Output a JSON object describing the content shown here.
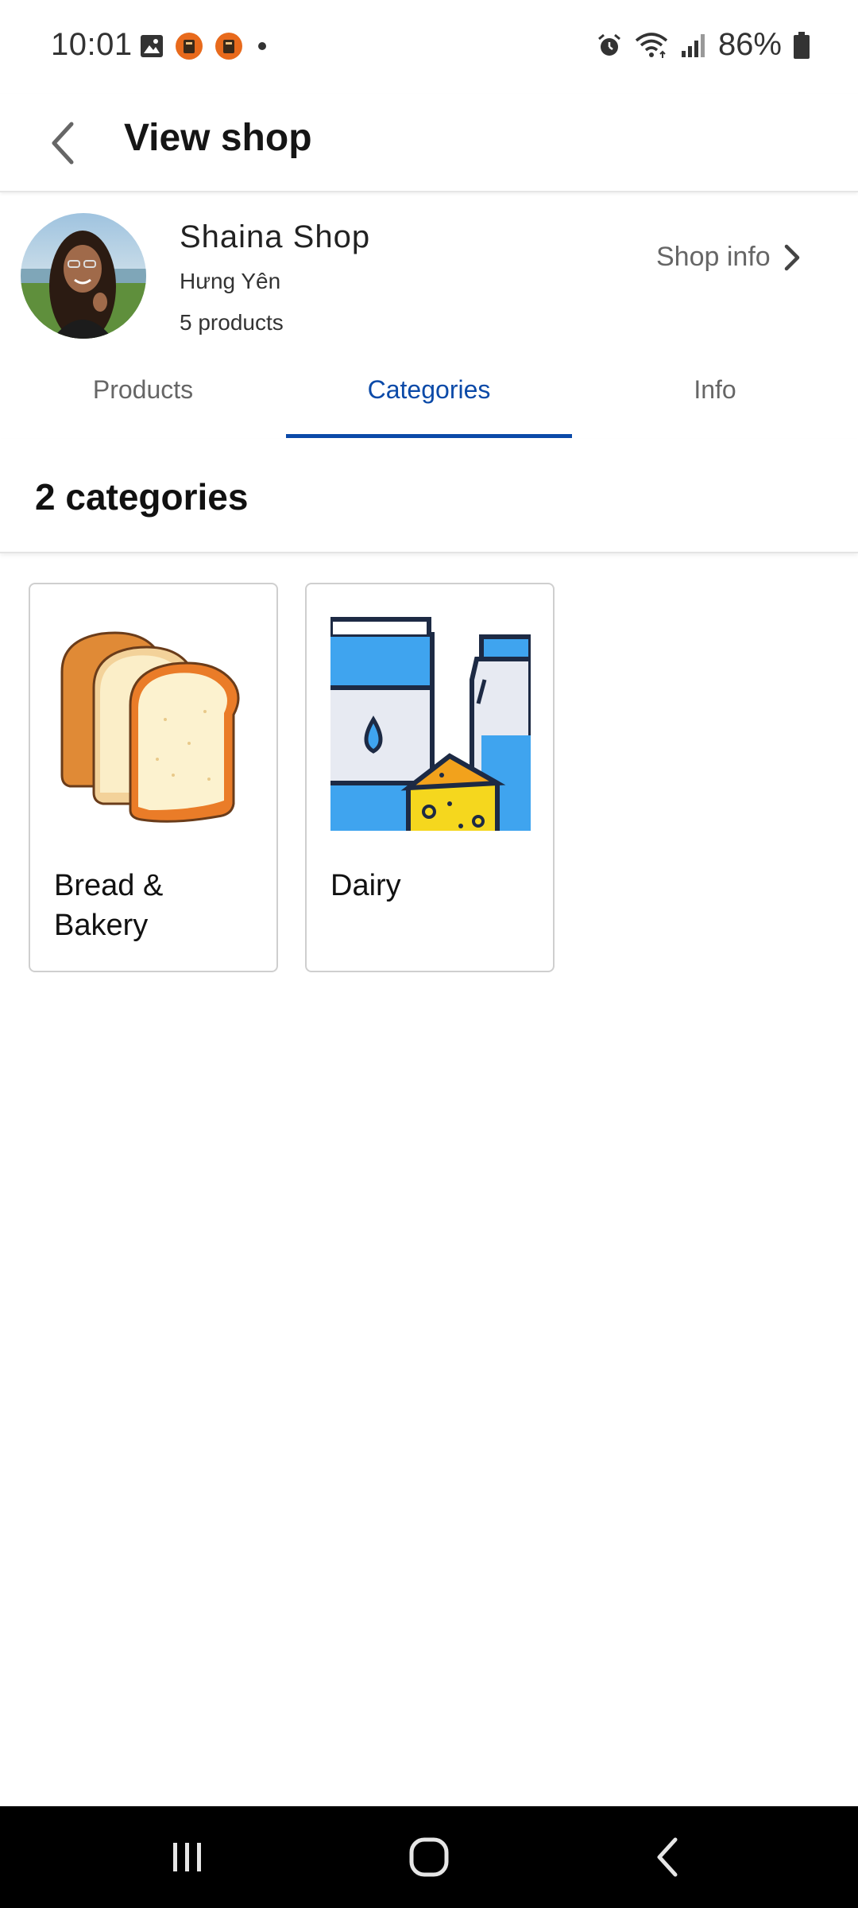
{
  "status_bar": {
    "time": "10:01",
    "battery": "86%",
    "icons": [
      "gallery-icon",
      "app-notification-icon",
      "app-notification-icon",
      "dot-icon",
      "alarm-icon",
      "wifi-icon",
      "signal-icon",
      "battery-icon"
    ]
  },
  "app_bar": {
    "title": "View shop",
    "back_icon": "chevron-left-icon"
  },
  "shop": {
    "name": "Shaina Shop",
    "location": "Hưng Yên",
    "products_count": "5 products",
    "info_link": "Shop info",
    "info_icon": "chevron-right-icon"
  },
  "tabs": [
    {
      "label": "Products",
      "active": false
    },
    {
      "label": "Categories",
      "active": true
    },
    {
      "label": "Info",
      "active": false
    }
  ],
  "section": {
    "title": "2 categories"
  },
  "categories": [
    {
      "label": "Bread & Bakery",
      "image": "bread-image"
    },
    {
      "label": "Dairy",
      "image": "dairy-image"
    }
  ],
  "colors": {
    "accent": "#0b4aa8",
    "text_secondary": "#666666",
    "navbar": "#000000"
  },
  "nav_bar": {
    "buttons": [
      "recent-apps-icon",
      "home-icon",
      "back-icon"
    ]
  }
}
